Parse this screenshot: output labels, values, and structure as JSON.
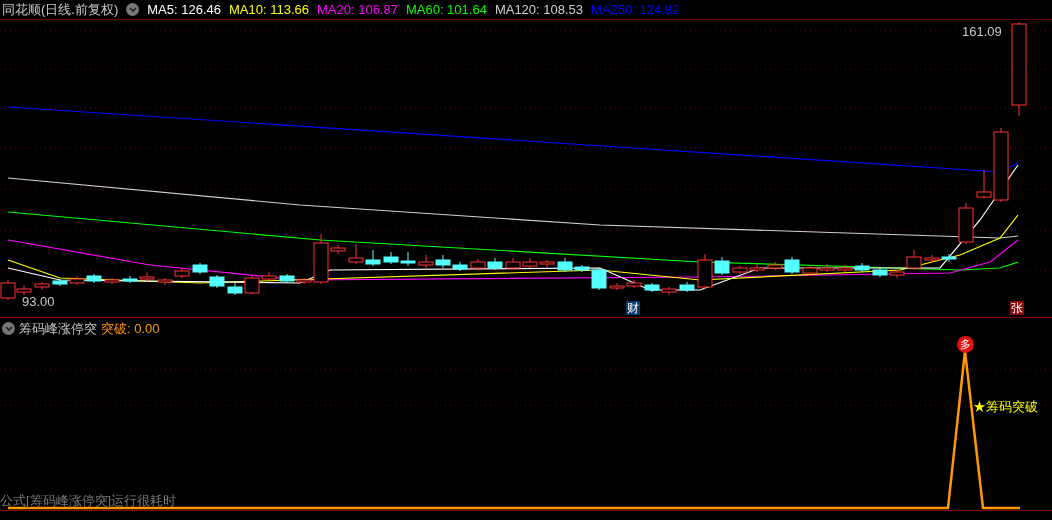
{
  "title": "同花顺(日线.前复权)",
  "ma_legend": [
    {
      "label": "MA5: 126.46",
      "color": "#ffffff"
    },
    {
      "label": "MA10: 113.66",
      "color": "#ffff00"
    },
    {
      "label": "MA20: 106.87",
      "color": "#ff00ff"
    },
    {
      "label": "MA60: 101.64",
      "color": "#00ff00"
    },
    {
      "label": "MA120: 108.53",
      "color": "#d0d0d0"
    },
    {
      "label": "MA250: 124.82",
      "color": "#0000ff"
    }
  ],
  "price_high": "161.09",
  "price_low": "93.00",
  "markers": [
    {
      "label": "财",
      "kind": "finance"
    },
    {
      "label": "张",
      "kind": "limit"
    }
  ],
  "indicator": {
    "name": "筹码峰涨停突",
    "value_label": "突破: 0.00",
    "signal_badge": "多",
    "signal_label": "★筹码突破",
    "warning": "公式[筹码峰涨停突]运行很耗时"
  }
}
